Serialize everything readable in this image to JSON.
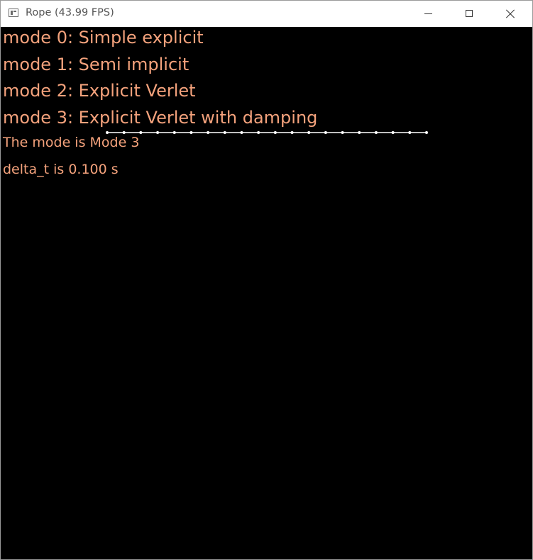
{
  "window": {
    "title": "Rope (43.99 FPS)",
    "controls": {
      "minimize": "minimize-icon",
      "maximize": "maximize-icon",
      "close": "close-icon"
    }
  },
  "overlay": {
    "text_color": "#f4a27c",
    "modes": [
      "mode 0: Simple explicit",
      "mode 1: Semi implicit",
      "mode 2: Explicit Verlet",
      "mode 3: Explicit Verlet with damping"
    ],
    "current_mode": "The mode is Mode 3",
    "delta_t": "delta_t is 0.100 s"
  },
  "rope": {
    "color": "#ffffff",
    "node_count": 20
  }
}
